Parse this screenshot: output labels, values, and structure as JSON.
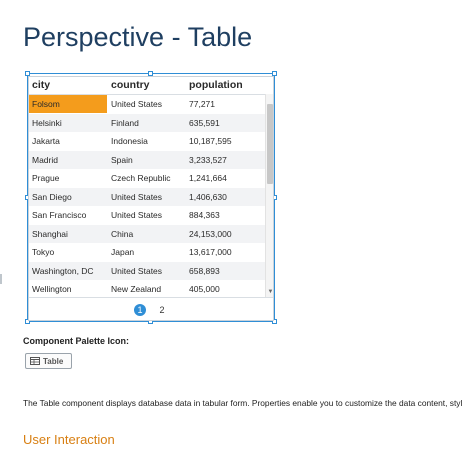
{
  "page": {
    "title": "Perspective - Table"
  },
  "table": {
    "columns": [
      "city",
      "country",
      "population"
    ],
    "rows": [
      {
        "city": "Folsom",
        "country": "United States",
        "population": "77,271"
      },
      {
        "city": "Helsinki",
        "country": "Finland",
        "population": "635,591"
      },
      {
        "city": "Jakarta",
        "country": "Indonesia",
        "population": "10,187,595"
      },
      {
        "city": "Madrid",
        "country": "Spain",
        "population": "3,233,527"
      },
      {
        "city": "Prague",
        "country": "Czech Republic",
        "population": "1,241,664"
      },
      {
        "city": "San Diego",
        "country": "United States",
        "population": "1,406,630"
      },
      {
        "city": "San Francisco",
        "country": "United States",
        "population": "884,363"
      },
      {
        "city": "Shanghai",
        "country": "China",
        "population": "24,153,000"
      },
      {
        "city": "Tokyo",
        "country": "Japan",
        "population": "13,617,000"
      },
      {
        "city": "Washington, DC",
        "country": "United States",
        "population": "658,893"
      },
      {
        "city": "Wellington",
        "country": "New Zealand",
        "population": "405,000"
      }
    ],
    "selected_row": 0,
    "selected_color": "#f49c1c",
    "pagination": {
      "pages": [
        "1",
        "2"
      ],
      "current": "1"
    },
    "accent_color": "#2f8ed6"
  },
  "palette": {
    "heading": "Component Palette Icon:",
    "chip_icon": "table-icon",
    "chip_label": "Table"
  },
  "description": "The Table component displays database data in tabular form. Properties enable you to customize the data content, styl",
  "section": {
    "heading": "User Interaction",
    "color": "#d87f12"
  }
}
